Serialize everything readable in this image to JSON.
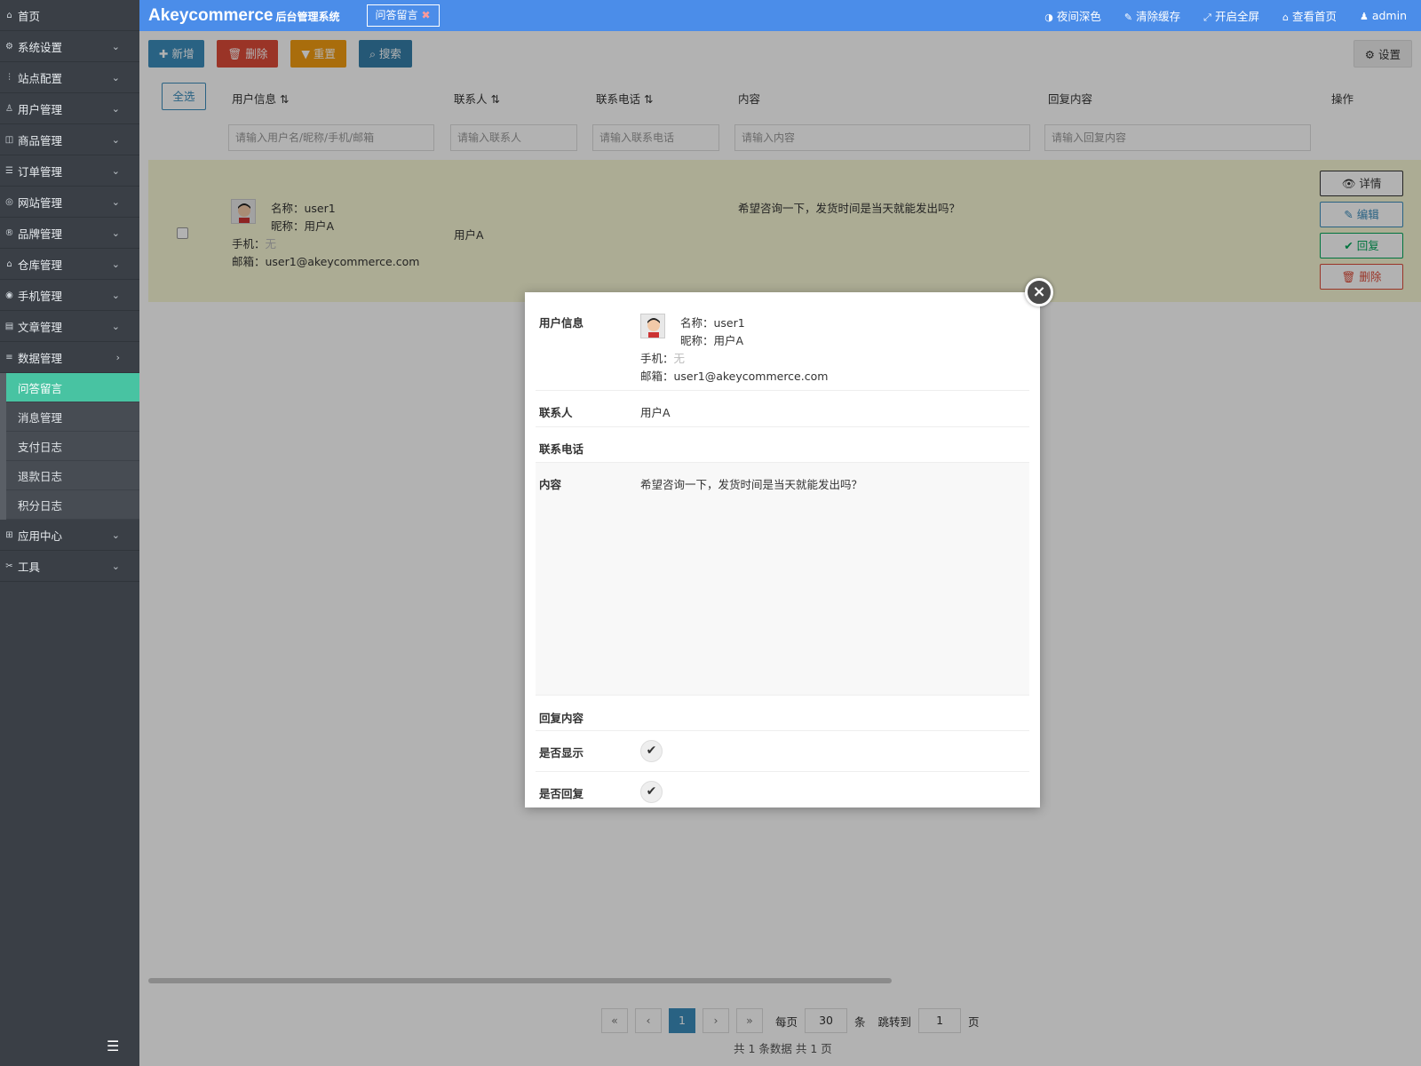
{
  "sidebar": {
    "home": "首页",
    "items": [
      {
        "label": "系统设置"
      },
      {
        "label": "站点配置"
      },
      {
        "label": "用户管理"
      },
      {
        "label": "商品管理"
      },
      {
        "label": "订单管理"
      },
      {
        "label": "网站管理"
      },
      {
        "label": "品牌管理"
      },
      {
        "label": "仓库管理"
      },
      {
        "label": "手机管理"
      },
      {
        "label": "文章管理"
      },
      {
        "label": "数据管理"
      }
    ],
    "sub_items": [
      "问答留言",
      "消息管理",
      "支付日志",
      "退款日志",
      "积分日志"
    ],
    "after_items": [
      "应用中心",
      "工具"
    ]
  },
  "header": {
    "brand": "Akeycommerce",
    "brand_sub": "后台管理系统",
    "tab": "问答留言",
    "links": [
      "夜间深色",
      "清除缓存",
      "开启全屏",
      "查看首页",
      "admin"
    ]
  },
  "toolbar": {
    "add": "新增",
    "delete": "删除",
    "reset": "重置",
    "search": "搜索",
    "settings": "设置"
  },
  "table": {
    "select_all": "全选",
    "columns": [
      "用户信息",
      "联系人",
      "联系电话",
      "内容",
      "回复内容",
      "操作"
    ],
    "placeholders": [
      "请输入用户名/昵称/手机/邮箱",
      "请输入联系人",
      "请输入联系电话",
      "请输入内容",
      "请输入回复内容"
    ],
    "row": {
      "name": "名称：user1",
      "nickname": "昵称：用户A",
      "phone_label": "手机：",
      "phone_value": "无",
      "email": "邮箱：user1@akeycommerce.com",
      "contact": "用户A",
      "content": "希望咨询一下，发货时间是当天就能发出吗？"
    },
    "actions": [
      "详情",
      "编辑",
      "回复",
      "删除"
    ]
  },
  "pager": {
    "current": "1",
    "per_page_label": "每页",
    "per_page": "30",
    "unit": "条",
    "jump_label": "跳转到",
    "jump_value": "1",
    "page_unit": "页",
    "summary": "共 1 条数据   共 1 页"
  },
  "modal": {
    "user_label": "用户信息",
    "name": "名称：user1",
    "nickname": "昵称：用户A",
    "phone_label": "手机：",
    "phone_value": "无",
    "email": "邮箱：user1@akeycommerce.com",
    "contact_label": "联系人",
    "contact_value": "用户A",
    "tel_label": "联系电话",
    "content_label": "内容",
    "content_value": "希望咨询一下，发货时间是当天就能发出吗？",
    "reply_label": "回复内容",
    "show_label": "是否显示",
    "replied_label": "是否回复"
  },
  "colors": {
    "header": "#4b8de9",
    "sidebar": "#3a3f46",
    "active_menu": "#48c3a2"
  }
}
